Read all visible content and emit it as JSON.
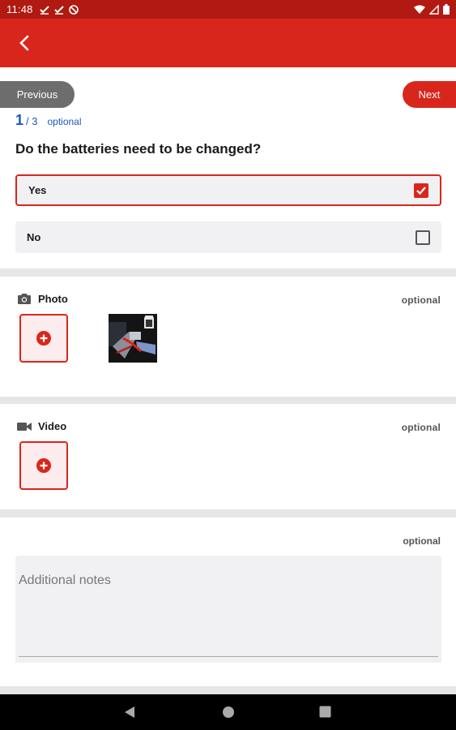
{
  "status_bar": {
    "time": "11:48"
  },
  "header": {
    "back_icon": "chevron-left-icon"
  },
  "navigation": {
    "previous_label": "Previous",
    "next_label": "Next"
  },
  "progress": {
    "current": "1",
    "total": "/ 3",
    "optional_label": "optional"
  },
  "question": {
    "text": "Do the batteries need to be changed?",
    "options": [
      {
        "label": "Yes",
        "checked": true
      },
      {
        "label": "No",
        "checked": false
      }
    ]
  },
  "photo_section": {
    "title": "Photo",
    "optional_label": "optional",
    "icon": "camera-icon"
  },
  "video_section": {
    "title": "Video",
    "optional_label": "optional",
    "icon": "video-camera-icon"
  },
  "notes_section": {
    "optional_label": "optional",
    "placeholder": "Additional notes"
  },
  "colors": {
    "accent": "#d9261c",
    "status_bar": "#b01a12",
    "link": "#1f57b8",
    "neutral_pill": "#6d6d6d"
  }
}
